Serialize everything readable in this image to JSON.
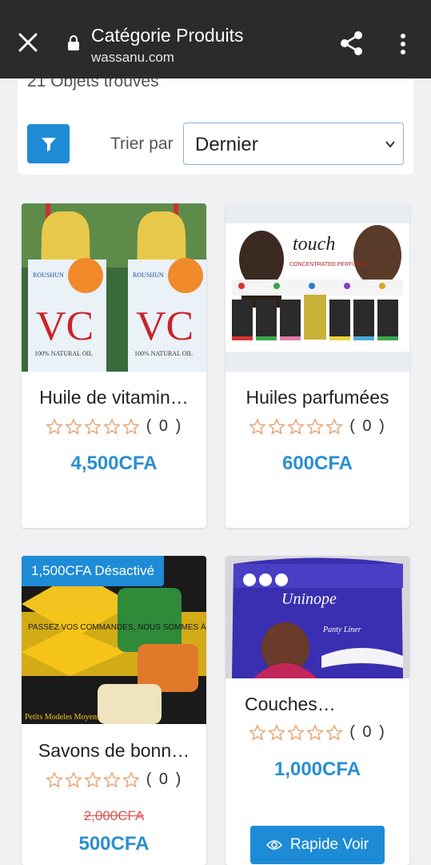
{
  "browser": {
    "title": "Catégorie Produits",
    "url": "wassanu.com"
  },
  "filters": {
    "found_text": "21 Objets trouves",
    "sort_label": "Trier par",
    "sort_value": "Dernier"
  },
  "products": [
    {
      "name": "Huile de vitamin…",
      "rating_count": "( 0 )",
      "price": "4,500CFA"
    },
    {
      "name": "Huiles parfumées",
      "rating_count": "( 0 )",
      "price": "600CFA"
    },
    {
      "name": "Savons de bonn…",
      "rating_count": "( 0 )",
      "old_price": "2,000CFA",
      "price": "500CFA",
      "badge": "1,500CFA Désactivé"
    },
    {
      "name": "Couches…",
      "rating_count": "( 0 )",
      "price": "1,000CFA",
      "quick_view": "Rapide Voir"
    }
  ],
  "product_images": [
    {
      "brand_text": "ROUSHUN",
      "label_big": "VC",
      "label_small": "100% NATURAL OIL"
    },
    {
      "brand_text": "touch",
      "subtitle": "CONCENTRATED PERFUMES"
    },
    {
      "headline": "PASSEZ VOS COMMANDES, NOUS SOMMES À VOTRE DISPOSITION",
      "footer": "Petits Modeles Moyens"
    },
    {
      "brand_text": "Uninope",
      "subtitle": "Panty Liner"
    }
  ],
  "colors": {
    "accent": "#1e8bd6",
    "price": "#2a8fd0",
    "old_price": "#e0524e",
    "star_outline": "#e8a070"
  }
}
